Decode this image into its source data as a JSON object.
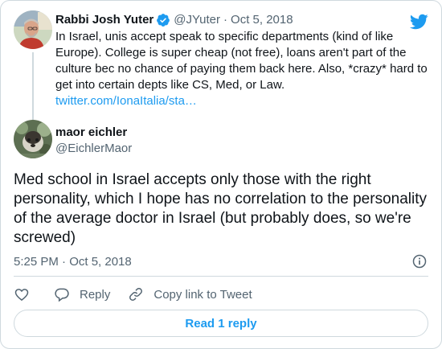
{
  "parent_tweet": {
    "name": "Rabbi Josh Yuter",
    "handle": "@JYuter",
    "separator": "·",
    "date": "Oct 5, 2018",
    "text": "In Israel, unis accept speak to specific departments (kind of like Europe). College is super cheap (not free), loans aren't part of the culture bec no chance of paying them back here. Also, *crazy* hard to get into certain depts like CS, Med, or Law.",
    "link": "twitter.com/IonaItalia/sta…"
  },
  "tweet": {
    "name": "maor eichler",
    "handle": "@EichlerMaor",
    "text": "Med school in Israel accepts only those with the right personality, which I hope has no correlation to the personality of the average doctor in Israel (but probably does, so we're screwed)",
    "timestamp": "5:25 PM · Oct 5, 2018"
  },
  "actions": {
    "reply": "Reply",
    "copy_link": "Copy link to Tweet"
  },
  "read_replies": "Read 1 reply",
  "colors": {
    "accent": "#1d9bf0",
    "text": "#0f1419",
    "muted": "#536471",
    "border": "#cfd9de"
  },
  "icons": [
    "verified-badge-icon",
    "twitter-bird-icon",
    "info-icon",
    "heart-icon",
    "reply-icon",
    "link-icon"
  ]
}
